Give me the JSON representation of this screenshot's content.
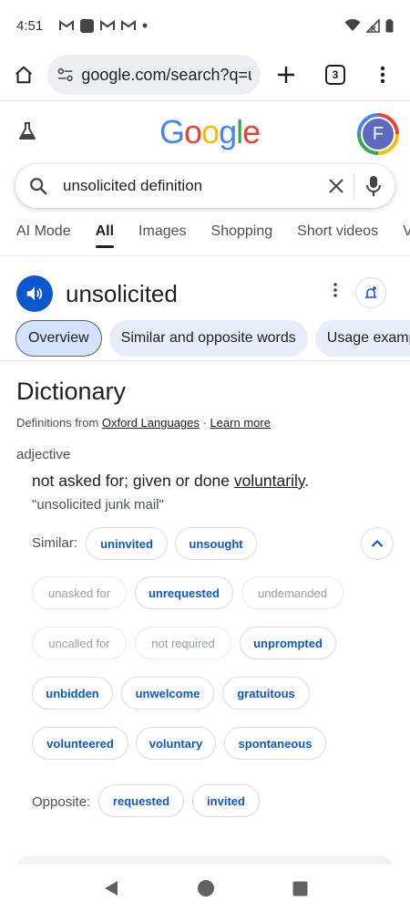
{
  "status_bar": {
    "time": "4:51",
    "left_icons": [
      "gmail-icon",
      "app-icon",
      "gmail-icon",
      "gmail-icon",
      "dot-icon"
    ],
    "right_icons": [
      "wifi-icon",
      "signal-icon",
      "battery-icon"
    ]
  },
  "toolbar": {
    "url": "google.com/search?q=u",
    "tab_count": "3"
  },
  "google_header": {
    "logo_letters": [
      {
        "ch": "G",
        "color": "#4285f4"
      },
      {
        "ch": "o",
        "color": "#ea4335"
      },
      {
        "ch": "o",
        "color": "#fbbc05"
      },
      {
        "ch": "g",
        "color": "#4285f4"
      },
      {
        "ch": "l",
        "color": "#34a853"
      },
      {
        "ch": "e",
        "color": "#ea4335"
      }
    ],
    "avatar_letter": "F"
  },
  "search": {
    "query": "unsolicited definition"
  },
  "tabs": [
    "AI Mode",
    "All",
    "Images",
    "Shopping",
    "Short videos",
    "Vi"
  ],
  "active_tab": "All",
  "word": "unsolicited",
  "section_chips": [
    "Overview",
    "Similar and opposite words",
    "Usage examp"
  ],
  "dictionary": {
    "title": "Dictionary",
    "source_prefix": "Definitions from ",
    "source_link": "Oxford Languages",
    "source_sep": " · ",
    "learn_more": "Learn more",
    "part_of_speech": "adjective",
    "definition_prefix": "not asked for; given or done ",
    "definition_link": "voluntarily",
    "definition_suffix": ".",
    "example": "\"unsolicited junk mail\"",
    "similar_label": "Similar:",
    "opposite_label": "Opposite:"
  },
  "similar_words": [
    {
      "text": "uninvited",
      "state": "link"
    },
    {
      "text": "unsought",
      "state": "link"
    },
    {
      "text": "unasked for",
      "state": "disabled"
    },
    {
      "text": "unrequested",
      "state": "link"
    },
    {
      "text": "undemanded",
      "state": "disabled"
    },
    {
      "text": "uncalled for",
      "state": "disabled"
    },
    {
      "text": "not required",
      "state": "disabled"
    },
    {
      "text": "unprompted",
      "state": "link"
    },
    {
      "text": "unbidden",
      "state": "link"
    },
    {
      "text": "unwelcome",
      "state": "link"
    },
    {
      "text": "gratuitous",
      "state": "link"
    },
    {
      "text": "volunteered",
      "state": "link"
    },
    {
      "text": "voluntary",
      "state": "link"
    },
    {
      "text": "spontaneous",
      "state": "link"
    }
  ],
  "opposite_words": [
    {
      "text": "requested",
      "state": "link"
    },
    {
      "text": "invited",
      "state": "link"
    }
  ],
  "colors": {
    "accent": "#0b57d0",
    "chip_active": "#d3e3fd",
    "chip_bg": "#e8eef9"
  }
}
